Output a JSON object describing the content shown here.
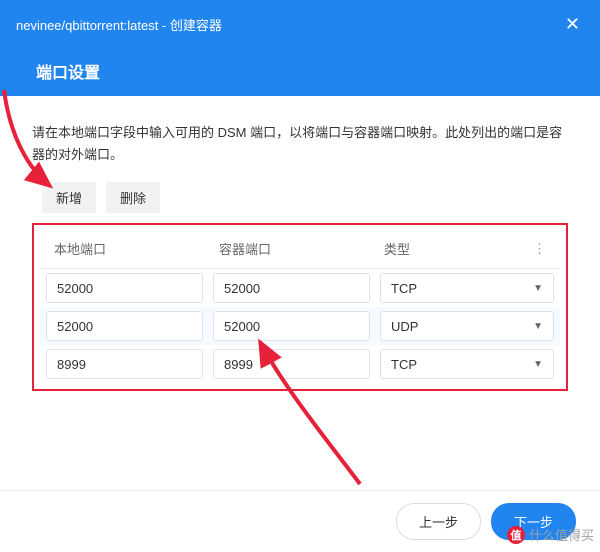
{
  "header": {
    "title": "nevinee/qbittorrent:latest - 创建容器",
    "subtitle": "端口设置"
  },
  "description": "请在本地端口字段中输入可用的 DSM 端口，以将端口与容器端口映射。此处列出的端口是容器的对外端口。",
  "toolbar": {
    "add": "新增",
    "delete": "删除"
  },
  "table": {
    "columns": {
      "local": "本地端口",
      "container": "容器端口",
      "type": "类型"
    },
    "rows": [
      {
        "local": "52000",
        "container": "52000",
        "type": "TCP"
      },
      {
        "local": "52000",
        "container": "52000",
        "type": "UDP"
      },
      {
        "local": "8999",
        "container": "8999",
        "type": "TCP"
      }
    ]
  },
  "footer": {
    "prev": "上一步",
    "next": "下一步"
  },
  "watermark": "什么值得买",
  "colors": {
    "accent": "#2185f0",
    "highlight": "#e8213a"
  }
}
